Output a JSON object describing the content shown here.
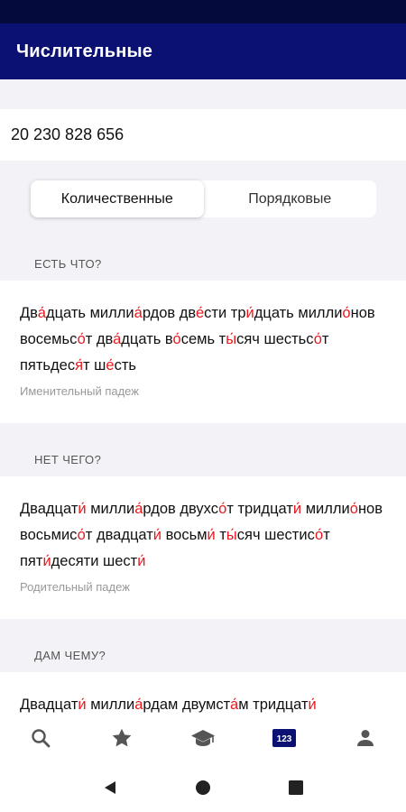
{
  "app_bar": {
    "title": "Числительные"
  },
  "input": {
    "number": "20 230 828 656"
  },
  "tabs": [
    {
      "label": "Количественные",
      "active": true
    },
    {
      "label": "Порядковые",
      "active": false
    }
  ],
  "sections": [
    {
      "header": "ЕСТЬ ЧТО?",
      "segments": [
        [
          "Дв",
          0
        ],
        [
          "а",
          1
        ],
        [
          "дцать милли",
          0
        ],
        [
          "а",
          1
        ],
        [
          "рдов дв",
          0
        ],
        [
          "е",
          1
        ],
        [
          "сти тр",
          0
        ],
        [
          "и",
          1
        ],
        [
          "дцать ",
          0
        ],
        [
          "милли",
          0
        ],
        [
          "о",
          1
        ],
        [
          "нов восемьс",
          0
        ],
        [
          "о",
          1
        ],
        [
          "т дв",
          0
        ],
        [
          "а",
          1
        ],
        [
          "дцать в",
          0
        ],
        [
          "о",
          1
        ],
        [
          "семь т",
          0
        ],
        [
          "ы",
          1
        ],
        [
          "сяч ",
          0
        ],
        [
          "шестьс",
          0
        ],
        [
          "о",
          1
        ],
        [
          "т пятьдес",
          0
        ],
        [
          "я",
          1
        ],
        [
          "т ш",
          0
        ],
        [
          "е",
          1
        ],
        [
          "сть",
          0
        ]
      ],
      "caption": "Именительный падеж"
    },
    {
      "header": "НЕТ ЧЕГО?",
      "segments": [
        [
          "Двадцат",
          0
        ],
        [
          "и",
          1
        ],
        [
          " милли",
          0
        ],
        [
          "а",
          1
        ],
        [
          "рдов двухс",
          0
        ],
        [
          "о",
          1
        ],
        [
          "т тридцат",
          0
        ],
        [
          "и",
          1
        ],
        [
          " ",
          0
        ],
        [
          "милли",
          0
        ],
        [
          "о",
          1
        ],
        [
          "нов восьмис",
          0
        ],
        [
          "о",
          1
        ],
        [
          "т двадцат",
          0
        ],
        [
          "и",
          1
        ],
        [
          " восьм",
          0
        ],
        [
          "и",
          1
        ],
        [
          " т",
          0
        ],
        [
          "ы",
          1
        ],
        [
          "сяч ",
          0
        ],
        [
          "шестис",
          0
        ],
        [
          "о",
          1
        ],
        [
          "т пят",
          0
        ],
        [
          "и",
          1
        ],
        [
          "десяти шест",
          0
        ],
        [
          "и",
          1
        ]
      ],
      "caption": "Родительный падеж"
    },
    {
      "header": "ДАМ ЧЕМУ?",
      "segments": [
        [
          "Двадцат",
          0
        ],
        [
          "и",
          1
        ],
        [
          " милли",
          0
        ],
        [
          "а",
          1
        ],
        [
          "рдам двумст",
          0
        ],
        [
          "а",
          1
        ],
        [
          "м тридцат",
          0
        ],
        [
          "и",
          1
        ]
      ],
      "caption": ""
    }
  ],
  "bottom_nav": [
    {
      "icon": "search-icon",
      "active": false
    },
    {
      "icon": "star-icon",
      "active": false
    },
    {
      "icon": "graduation-cap-icon",
      "active": false
    },
    {
      "icon": "numbers-icon",
      "label": "123",
      "active": true
    },
    {
      "icon": "person-icon",
      "active": false
    }
  ],
  "colors": {
    "app_bar": "#0a1172",
    "status_bar": "#050a3c",
    "accent": "#e8191e",
    "active_nav": "#0a1172",
    "inactive_nav": "#555555"
  }
}
